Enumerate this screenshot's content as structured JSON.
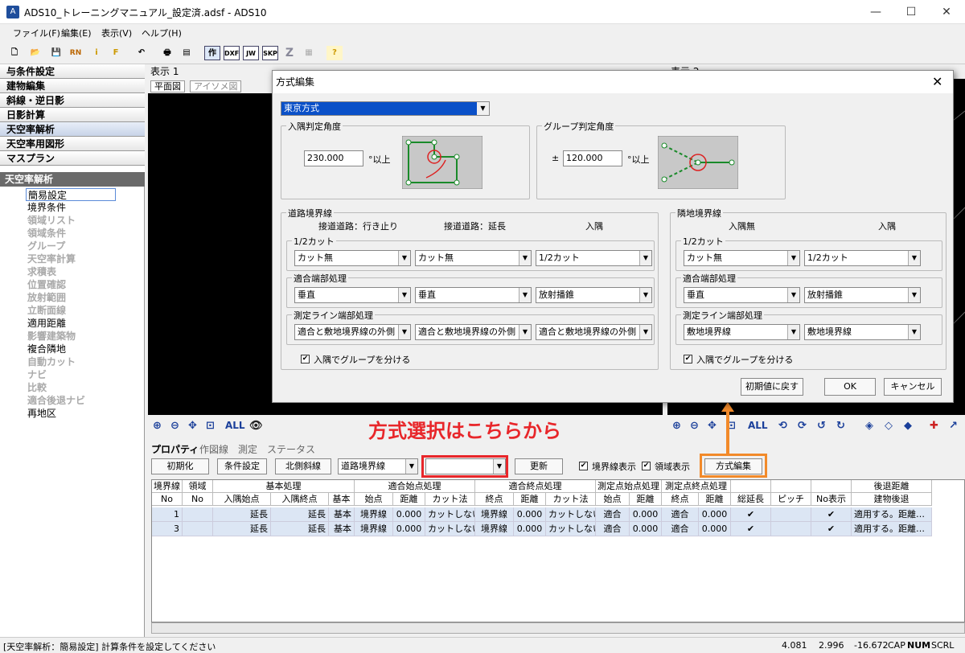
{
  "app": {
    "title": "ADS10_トレーニングマニュアル_設定済.adsf - ADS10",
    "icon": "A"
  },
  "window": {
    "minimize": "—",
    "maximize": "☐",
    "close": "✕"
  },
  "menu": [
    "ファイル(F)",
    "編集(E)",
    "表示(V)",
    "ヘルプ(H)"
  ],
  "toolbar": {
    "buttons": [
      "作",
      "DXF",
      "JW",
      "SKP",
      "Z"
    ]
  },
  "sidebar": {
    "headers": [
      "与条件設定",
      "建物編集",
      "斜線・逆日影",
      "日影計算",
      "天空率解析",
      "天空率用図形",
      "マスプラン"
    ],
    "section": "天空率解析",
    "items": [
      {
        "label": "簡易設定",
        "state": "selected"
      },
      {
        "label": "境界条件",
        "state": "normal"
      },
      {
        "label": "領域リスト",
        "state": "dim"
      },
      {
        "label": "領域条件",
        "state": "dim"
      },
      {
        "label": "グループ",
        "state": "dim"
      },
      {
        "label": "天空率計算",
        "state": "dim"
      },
      {
        "label": "求積表",
        "state": "dim"
      },
      {
        "label": "位置確認",
        "state": "dim"
      },
      {
        "label": "放射範囲",
        "state": "dim"
      },
      {
        "label": "立断面線",
        "state": "dim"
      },
      {
        "label": "適用距離",
        "state": "normal"
      },
      {
        "label": "影響建築物",
        "state": "dim"
      },
      {
        "label": "複合隣地",
        "state": "normal"
      },
      {
        "label": "自動カット",
        "state": "dim"
      },
      {
        "label": "ナビ",
        "state": "dim"
      },
      {
        "label": "比較",
        "state": "dim"
      },
      {
        "label": "適合後退ナビ",
        "state": "dim"
      },
      {
        "label": "再地区",
        "state": "normal"
      }
    ]
  },
  "view1": {
    "title": "表示 1",
    "tabs": [
      "平面図",
      "アイソメ図"
    ],
    "all": "ALL"
  },
  "view2": {
    "title": "表示 2",
    "all": "ALL"
  },
  "dialog": {
    "title": "方式編集",
    "close": "✕",
    "method": "東京方式",
    "irisumi": {
      "label": "入隅判定角度",
      "value": "230.000",
      "unit": "°以上"
    },
    "group": {
      "label": "グループ判定角度",
      "prefix": "±",
      "value": "120.000",
      "unit": "°以上"
    },
    "road": {
      "label": "道路境界線",
      "cols": [
        "接道道路：行き止り",
        "接道道路：延長",
        "入隅"
      ],
      "cut": {
        "label": "1/2カット",
        "values": [
          "カット無",
          "カット無",
          "1/2カット"
        ]
      },
      "end": {
        "label": "適合端部処理",
        "values": [
          "垂直",
          "垂直",
          "放射播錐"
        ]
      },
      "line": {
        "label": "測定ライン端部処理",
        "values": [
          "適合と敷地境界線の外側",
          "適合と敷地境界線の外側",
          "適合と敷地境界線の外側"
        ]
      },
      "check": "入隅でグループを分ける"
    },
    "adj": {
      "label": "隣地境界線",
      "cols": [
        "入隅無",
        "入隅"
      ],
      "cut": {
        "label": "1/2カット",
        "values": [
          "カット無",
          "1/2カット"
        ]
      },
      "end": {
        "label": "適合端部処理",
        "values": [
          "垂直",
          "放射播錐"
        ]
      },
      "line": {
        "label": "測定ライン端部処理",
        "values": [
          "敷地境界線",
          "敷地境界線"
        ]
      },
      "check": "入隅でグループを分ける"
    },
    "reset": "初期値に戻す",
    "ok": "OK",
    "cancel": "キャンセル"
  },
  "annotation": {
    "text": "方式選択はこちらから",
    "color": "#e8262a",
    "box_red": "#e8262a",
    "box_orange": "#f28a2a"
  },
  "bottom": {
    "tabs": [
      "プロパティ",
      "作図線",
      "測定",
      "ステータス"
    ],
    "init": "初期化",
    "cond": "条件設定",
    "north": "北側斜線",
    "road_combo": "道路境界線",
    "method_combo": "",
    "update": "更新",
    "chk_boundary": "境界線表示",
    "chk_region": "領域表示",
    "method_edit": "方式編集"
  },
  "grid": {
    "groups": [
      "境界線",
      "領域",
      "基本処理",
      "適合始点処理",
      "適合終点処理",
      "測定点始点処理",
      "測定点終点処理",
      "",
      "",
      "",
      "後退距離"
    ],
    "headers": [
      "No",
      "No",
      "入隅始点",
      "入隅終点",
      "基本",
      "始点",
      "距離",
      "カット法",
      "終点",
      "距離",
      "カット法",
      "始点",
      "距離",
      "終点",
      "距離",
      "総延長",
      "ピッチ",
      "No表示",
      "建物後退"
    ],
    "rows": [
      [
        "1",
        "",
        "延長",
        "延長",
        "基本",
        "境界線",
        "0.000",
        "カットしない",
        "境界線",
        "0.000",
        "カットしない",
        "適合",
        "0.000",
        "適合",
        "0.000",
        "✔",
        "",
        "✔",
        "適用する。距離…"
      ],
      [
        "3",
        "",
        "延長",
        "延長",
        "基本",
        "境界線",
        "0.000",
        "カットしない",
        "境界線",
        "0.000",
        "カットしない",
        "適合",
        "0.000",
        "適合",
        "0.000",
        "✔",
        "",
        "✔",
        "適用する。距離…"
      ]
    ]
  },
  "status": {
    "message": "[天空率解析：簡易設定] 計算条件を設定してください",
    "x": "4.081",
    "y": "2.996",
    "z": "-16.672",
    "cap": "CAP",
    "num": "NUM",
    "scrl": "SCRL"
  }
}
